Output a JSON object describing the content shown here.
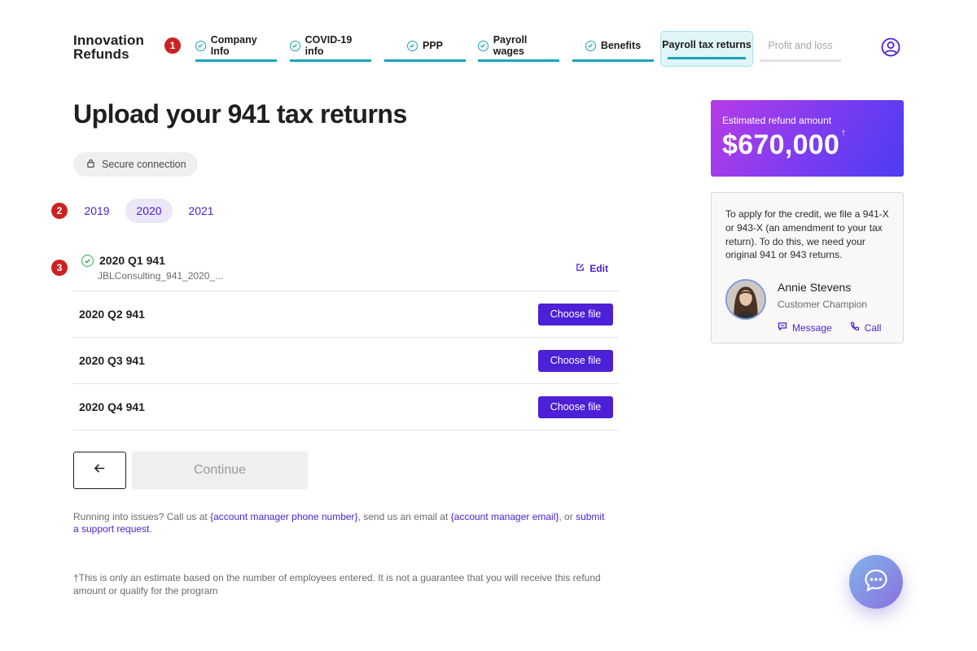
{
  "brand": {
    "line1": "Innovation",
    "line2": "Refunds"
  },
  "badges": [
    "1",
    "2",
    "3"
  ],
  "steps": [
    {
      "label": "Company Info",
      "status": "complete"
    },
    {
      "label": "COVID-19 info",
      "status": "complete"
    },
    {
      "label": "PPP",
      "status": "complete"
    },
    {
      "label": "Payroll wages",
      "status": "complete"
    },
    {
      "label": "Benefits",
      "status": "complete"
    },
    {
      "label": "Payroll tax returns",
      "status": "active"
    },
    {
      "label": "Profit and loss",
      "status": "upcoming"
    }
  ],
  "page": {
    "title": "Upload your 941 tax returns",
    "secure_label": "Secure connection"
  },
  "year_tabs": [
    {
      "label": "2019",
      "selected": false
    },
    {
      "label": "2020",
      "selected": true
    },
    {
      "label": "2021",
      "selected": false
    }
  ],
  "returns": [
    {
      "name": "2020 Q1 941",
      "uploaded": true,
      "file": "JBLConsulting_941_2020_...",
      "action": "Edit"
    },
    {
      "name": "2020 Q2 941",
      "uploaded": false,
      "action": "Choose file"
    },
    {
      "name": "2020 Q3 941",
      "uploaded": false,
      "action": "Choose file"
    },
    {
      "name": "2020 Q4 941",
      "uploaded": false,
      "action": "Choose file"
    }
  ],
  "buttons": {
    "continue": "Continue"
  },
  "help": {
    "part1": "Running into issues? Call us at ",
    "phone_link": "{account manager phone number}",
    "part2": ", send us an email at ",
    "email_link": "{account manager email}",
    "part3": ", or ",
    "support_link": "submit a support request",
    "part4": "."
  },
  "footnote": "†This is only an estimate based on the number of employees entered. It is not a guarantee that you will receive this refund amount or qualify for the program",
  "refund": {
    "label": "Estimated refund amount",
    "amount": "$670,000",
    "mark": "†"
  },
  "info": {
    "text": "To apply for the credit, we file a 941-X or 943-X (an amendment to your tax return). To do this, we need your original 941 or 943 returns.",
    "agent_name": "Annie Stevens",
    "agent_role": "Customer Champion",
    "message_label": "Message",
    "call_label": "Call"
  },
  "icons": {
    "user": "user-circle-icon",
    "lock": "lock-icon",
    "check": "check-circle-icon",
    "edit": "edit-icon",
    "back": "arrow-left-icon",
    "message": "message-icon",
    "call": "phone-icon",
    "chat": "chat-bubble-icon"
  },
  "colors": {
    "accent": "#4d1fd6",
    "step_complete": "#1aa3b8",
    "success": "#34a853",
    "badge": "#cc2222"
  }
}
